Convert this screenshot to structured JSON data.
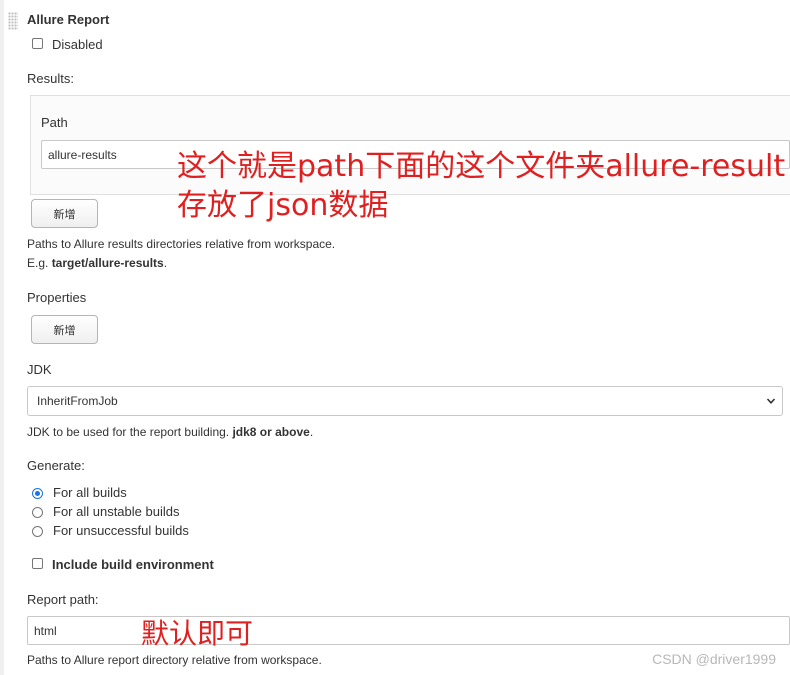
{
  "section": {
    "title": "Allure Report",
    "disabled_label": "Disabled",
    "disabled_checked": false
  },
  "results": {
    "label": "Results:",
    "path_label": "Path",
    "path_value": "allure-results",
    "add_button": "新增",
    "help_line1": "Paths to Allure results directories relative from workspace.",
    "help_line2_prefix": "E.g. ",
    "help_line2_bold": "target/allure-results",
    "help_line2_suffix": "."
  },
  "properties": {
    "label": "Properties",
    "add_button": "新增"
  },
  "jdk": {
    "label": "JDK",
    "selected": "InheritFromJob",
    "help_prefix": "JDK to be used for the report building. ",
    "help_bold": "jdk8 or above",
    "help_suffix": "."
  },
  "generate": {
    "label": "Generate:",
    "options": [
      {
        "label": "For all builds",
        "checked": true
      },
      {
        "label": "For all unstable builds",
        "checked": false
      },
      {
        "label": "For unsuccessful builds",
        "checked": false
      }
    ]
  },
  "build_env": {
    "label": "Include build environment",
    "checked": false
  },
  "report_path": {
    "label": "Report path:",
    "value": "html",
    "help": "Paths to Allure report directory relative from workspace."
  },
  "annotations": {
    "line1": "这个就是path下面的这个文件夹allure-result",
    "line2": "存放了json数据",
    "line3": "默认即可",
    "color": "#e02020"
  },
  "watermark": "CSDN @driver1999"
}
